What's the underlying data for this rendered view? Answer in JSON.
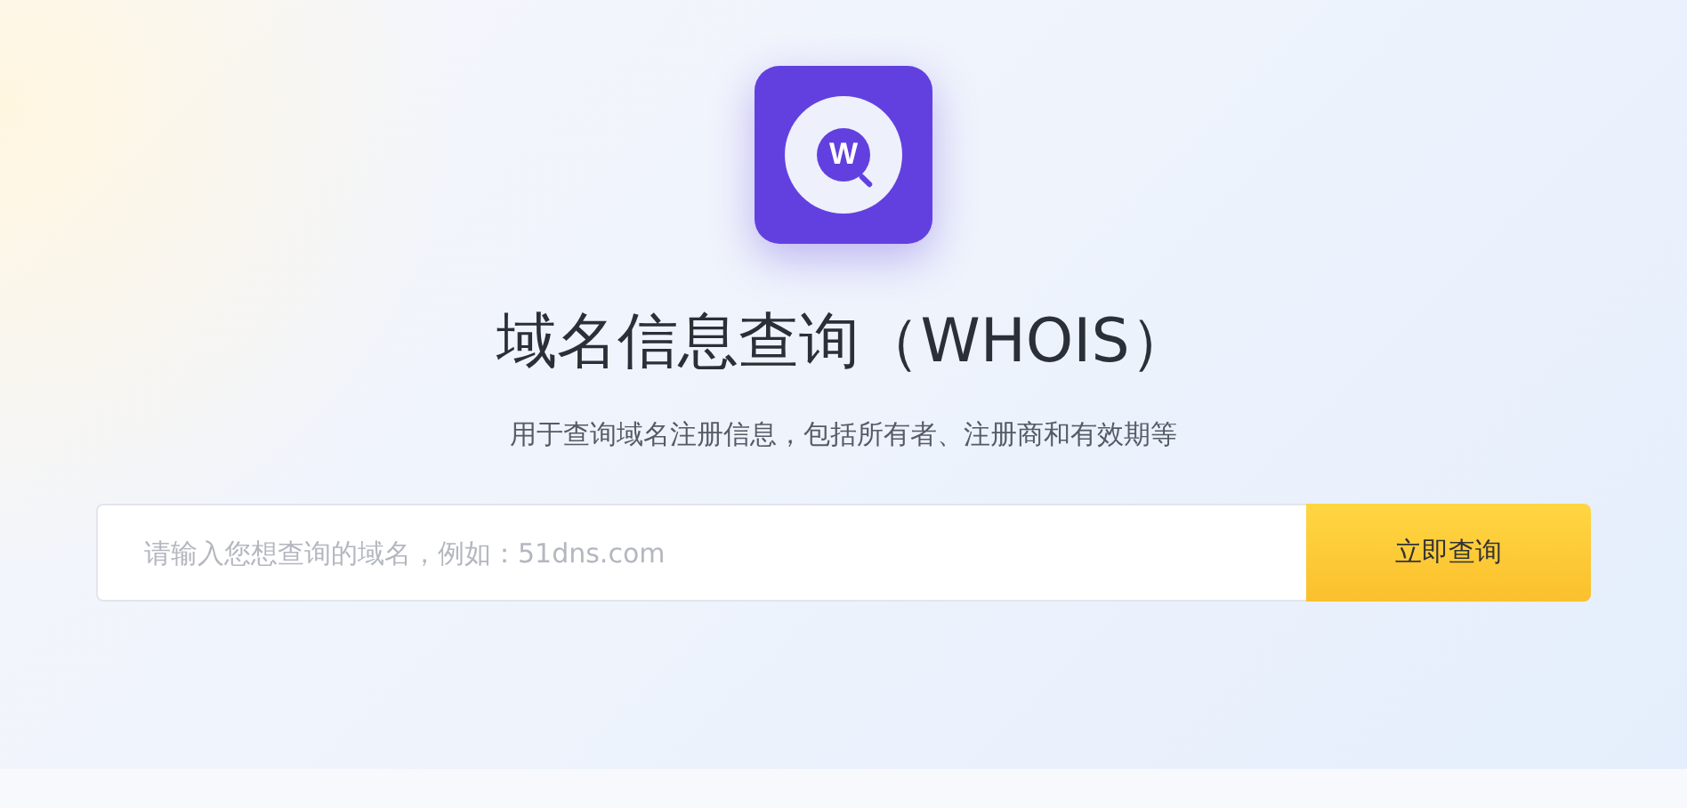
{
  "logo": {
    "letter": "W"
  },
  "title": "域名信息查询（WHOIS）",
  "subtitle": "用于查询域名注册信息，包括所有者、注册商和有效期等",
  "search": {
    "placeholder": "请输入您想查询的域名，例如：51dns.com"
  },
  "buttons": [
    "立即查询"
  ]
}
